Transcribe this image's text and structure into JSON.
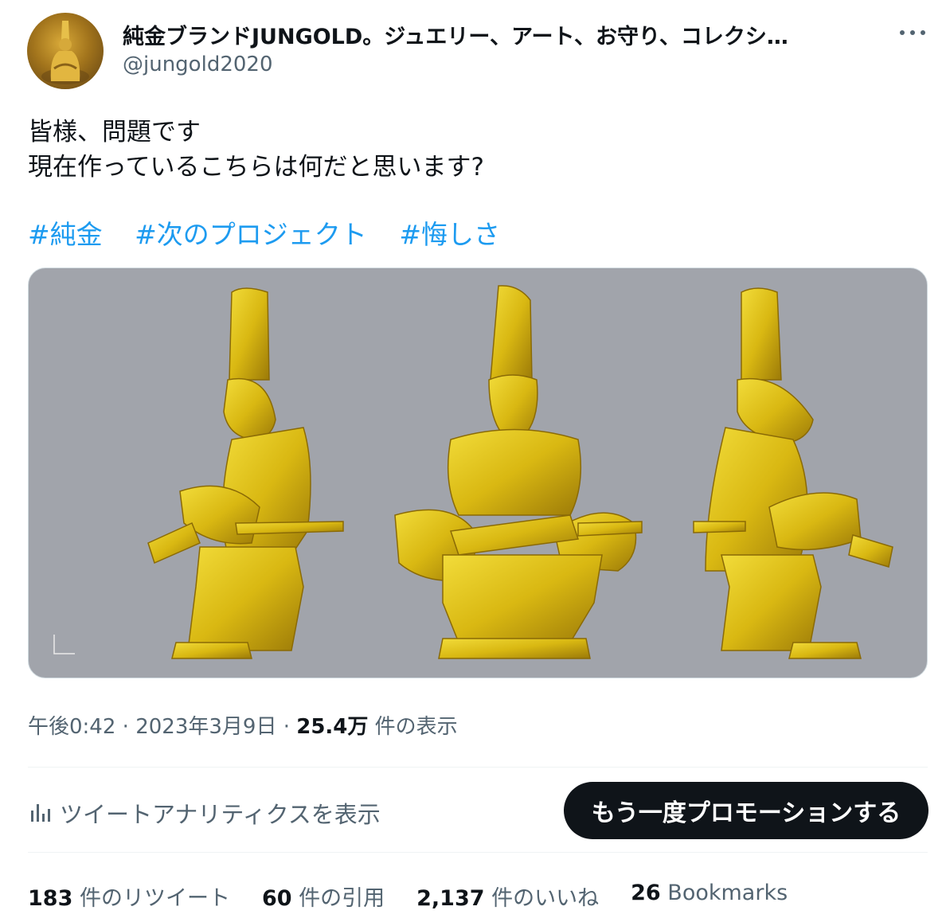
{
  "author": {
    "display_name": "純金ブランドJUNGOLD。ジュエリー、アート、お守り、コレクシ…",
    "handle": "@jungold2020"
  },
  "tweet": {
    "line1": "皆様、問題です",
    "line2": "現在作っているこちらは何だと思います?",
    "hashtags": [
      "#純金",
      "#次のプロジェクト",
      "#悔しさ"
    ]
  },
  "meta": {
    "time": "午後0:42",
    "sep1": " · ",
    "date": "2023年3月9日",
    "sep2": " · ",
    "views": "25.4万",
    "views_label": " 件の表示"
  },
  "actions": {
    "analytics_label": "ツイートアナリティクスを表示",
    "promote_label": "もう一度プロモーションする"
  },
  "stats": {
    "retweets": "183",
    "retweets_label": " 件のリツイート",
    "quotes": "60",
    "quotes_label": " 件の引用",
    "likes": "2,137",
    "likes_label": " 件のいいね",
    "bookmarks": "26",
    "bookmarks_label": " Bookmarks"
  },
  "colors": {
    "accent": "#1d9bf0",
    "text": "#0f1419",
    "secondary": "#536471",
    "media_bg": "#a1a4ab",
    "gold": "#d4b110"
  },
  "icons": {
    "more": "more-horizontal-icon",
    "analytics": "bar-chart-icon"
  }
}
